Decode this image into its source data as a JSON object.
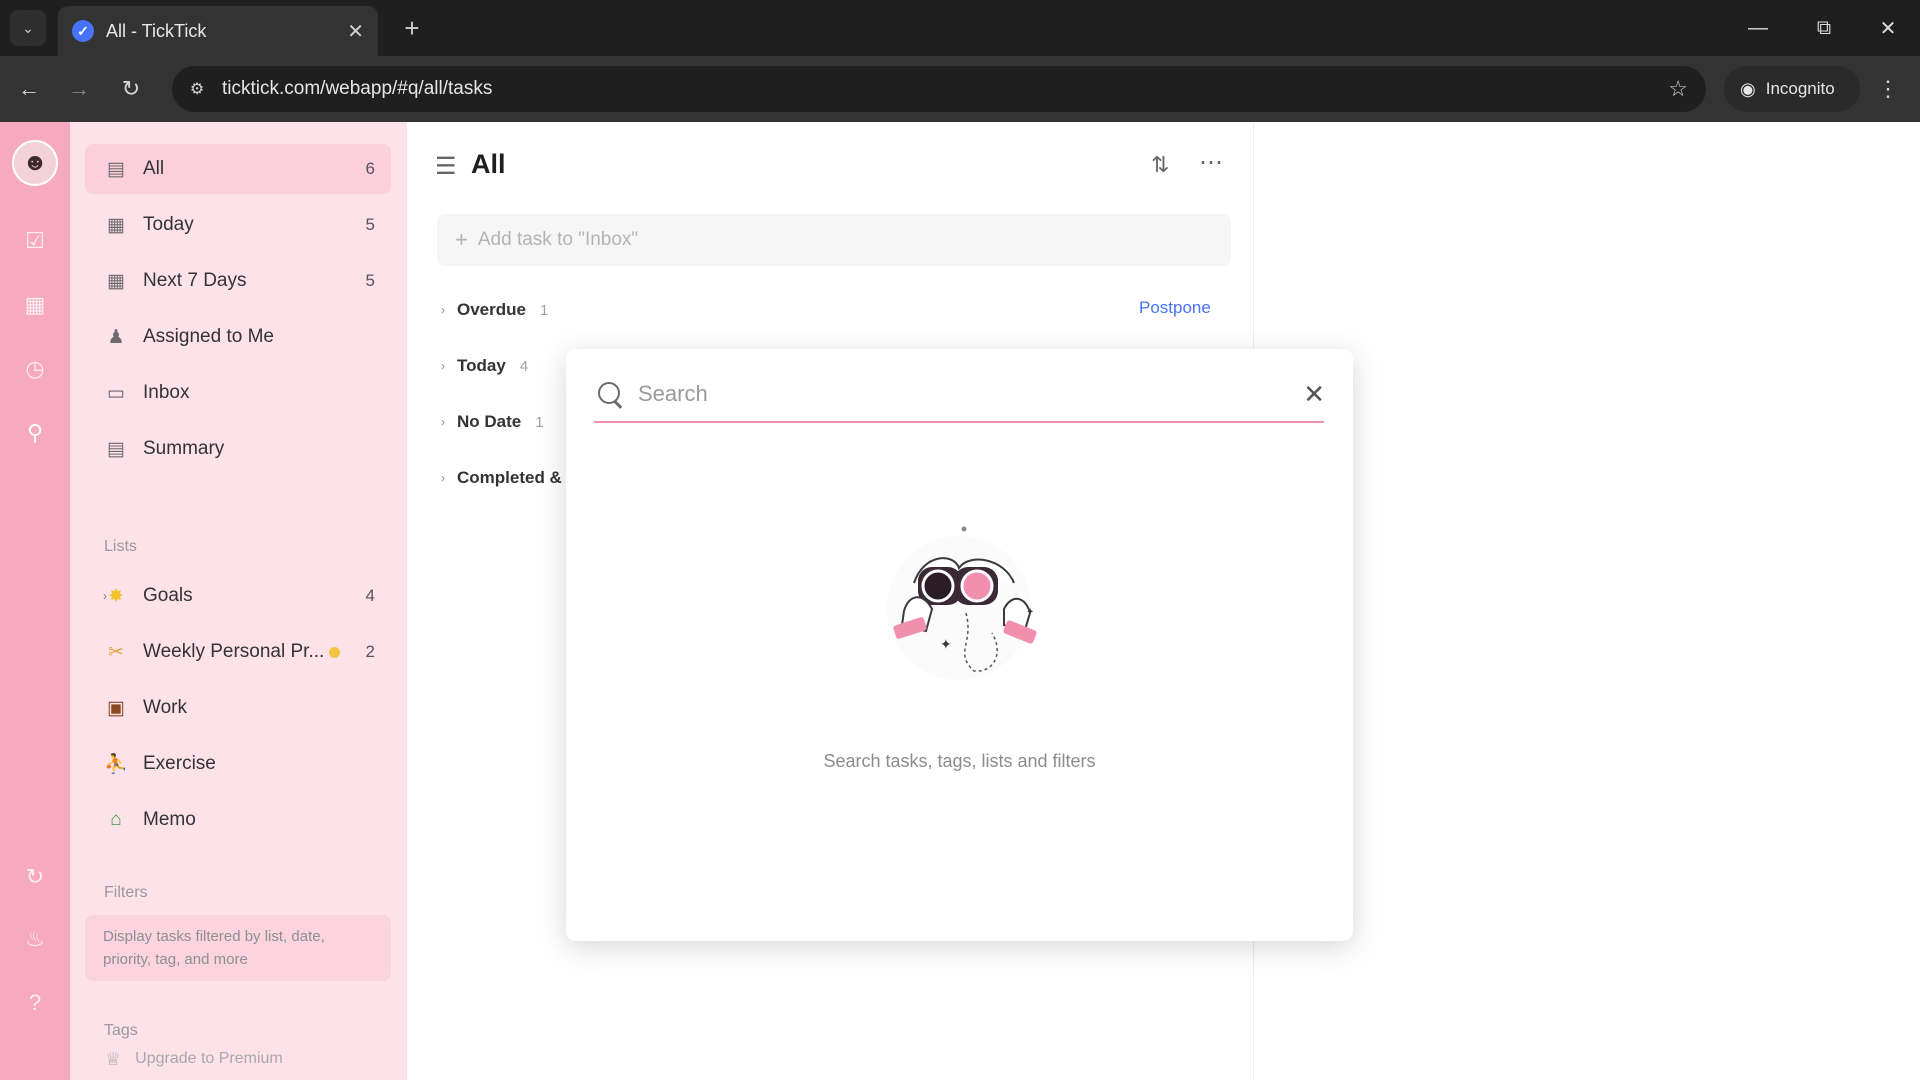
{
  "browser": {
    "tab_title": "All - TickTick",
    "url": "ticktick.com/webapp/#q/all/tasks",
    "incognito_label": "Incognito"
  },
  "sidebar": {
    "smart_lists": [
      {
        "label": "All",
        "count": "6",
        "icon": "all-icon"
      },
      {
        "label": "Today",
        "count": "5",
        "icon": "calendar-today-icon"
      },
      {
        "label": "Next 7 Days",
        "count": "5",
        "icon": "calendar-week-icon"
      },
      {
        "label": "Assigned to Me",
        "count": "",
        "icon": "person-icon"
      },
      {
        "label": "Inbox",
        "count": "",
        "icon": "inbox-icon"
      },
      {
        "label": "Summary",
        "count": "",
        "icon": "summary-icon"
      }
    ],
    "lists_heading": "Lists",
    "lists": [
      {
        "label": "Goals",
        "count": "4",
        "icon": "star-icon"
      },
      {
        "label": "Weekly Personal Pr...",
        "count": "2",
        "icon": "flex-arm-icon"
      },
      {
        "label": "Work",
        "count": "",
        "icon": "briefcase-icon"
      },
      {
        "label": "Exercise",
        "count": "",
        "icon": "runner-icon"
      },
      {
        "label": "Memo",
        "count": "",
        "icon": "house-icon"
      }
    ],
    "filters_heading": "Filters",
    "filters_hint": "Display tasks filtered by list, date, priority, tag, and more",
    "tags_heading": "Tags",
    "premium_label": "Upgrade to Premium"
  },
  "main": {
    "title": "All",
    "add_task_placeholder": "Add task to \"Inbox\"",
    "groups": [
      {
        "label": "Overdue",
        "count": "1"
      },
      {
        "label": "Today",
        "count": "4"
      },
      {
        "label": "No Date",
        "count": "1"
      },
      {
        "label": "Completed & W",
        "count": ""
      }
    ],
    "postpone_label": "Postpone"
  },
  "search_modal": {
    "placeholder": "Search",
    "value": "",
    "hint": "Search tasks, tags, lists and filters"
  },
  "colors": {
    "rail": "#f7a9c0",
    "sidebar": "#fde2ea",
    "accent_pink": "#f08fae",
    "link_blue": "#4772fa"
  }
}
